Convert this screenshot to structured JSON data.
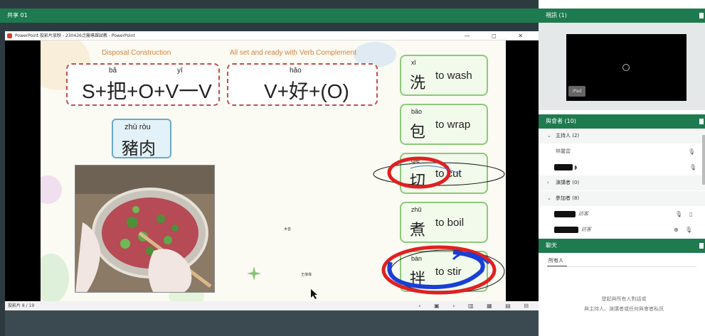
{
  "share": {
    "header": "共享 01"
  },
  "ppt": {
    "window_title": "PowerPoint 投影片放映 - 230426泛屬導課試教 - PowerPoint",
    "window_controls": "— ◻ ✕",
    "status_text": "投影片 8 / 19",
    "status_icons": "‹ ▣ › ▥ ▦ ▤ ⊟"
  },
  "slide": {
    "section1_title": "Disposal Construction",
    "section2_title": "All set and ready with Verb Complement",
    "formula1": "S+把+O+V一V",
    "formula1_py1": "bǎ",
    "formula1_py2": "yī",
    "formula2": "V+好+(O)",
    "formula2_py": "hǎo",
    "pork_pinyin": "zhū ròu",
    "pork_hanzi": "豬肉",
    "small_name1": "木音",
    "small_name2": "王偉偉",
    "verbs": [
      {
        "pinyin": "xǐ",
        "hanzi": "洗",
        "english": "to wash"
      },
      {
        "pinyin": "bāo",
        "hanzi": "包",
        "english": "to wrap"
      },
      {
        "pinyin": "qiē",
        "hanzi": "切",
        "english": "to cut"
      },
      {
        "pinyin": "zhǔ",
        "hanzi": "煮",
        "english": "to boil"
      },
      {
        "pinyin": "bàn",
        "hanzi": "拌",
        "english": "to stir"
      }
    ]
  },
  "panel": {
    "video_header": "視訊 (1)",
    "video_label": "iPad",
    "attendees_header": "與會者 (10)",
    "hosts_label": "主持人 (2)",
    "host1_name": "林馨雲",
    "presenters_label": "演講者 (0)",
    "participants_label": "參加者 (8)",
    "guest_label": "訪客",
    "chat_header": "聊天",
    "chat_tab": "所有人",
    "chat_hint1": "發起與所有人對話或",
    "chat_hint2": "與主持人、演講者或任何與會者私訊"
  },
  "colors": {
    "brand_green": "#1e7a4f",
    "annotation_red": "#e02020",
    "annotation_blue": "#1a3fd6"
  }
}
